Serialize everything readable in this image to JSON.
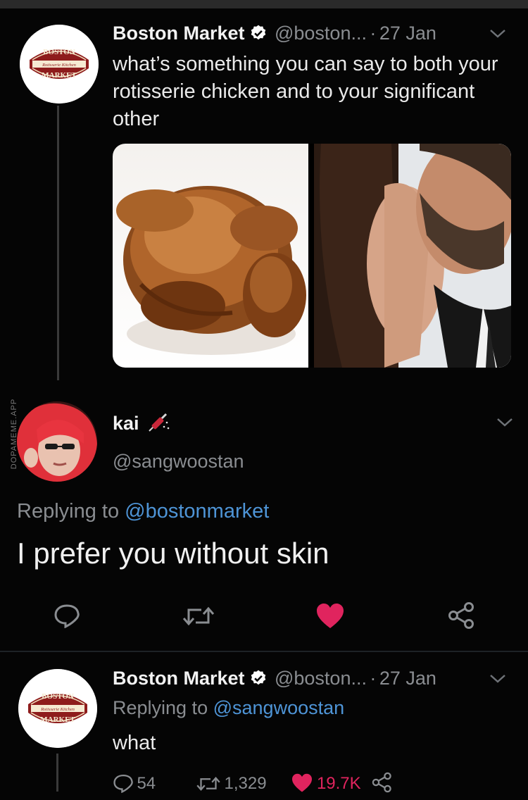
{
  "watermark": "DOPAMEME.APP",
  "tweet1": {
    "name": "Boston Market",
    "handle": "@boston...",
    "sep": "·",
    "date": "27 Jan",
    "text": "what’s something you can say to both your rotisserie chicken and to your significant other",
    "avatar_logo": "BOSTON MARKET Rotisserie Kitchen"
  },
  "reply1": {
    "name": "kai",
    "emoji_icon": "syringe-icon",
    "handle": "@sangwoostan",
    "replying_prefix": "Replying to",
    "replying_to": "@bostonmarket",
    "text": "I prefer you without skin",
    "liked_color": "#e0245e"
  },
  "tweet2": {
    "name": "Boston Market",
    "handle": "@boston...",
    "sep": "·",
    "date": "27 Jan",
    "replying_prefix": "Replying to",
    "replying_to": "@sangwoostan",
    "text": "what",
    "replies": "54",
    "retweets": "1,329",
    "likes": "19.7K"
  },
  "colors": {
    "link": "#4e94d6",
    "like": "#e0245e",
    "verified": "#ffffff"
  }
}
